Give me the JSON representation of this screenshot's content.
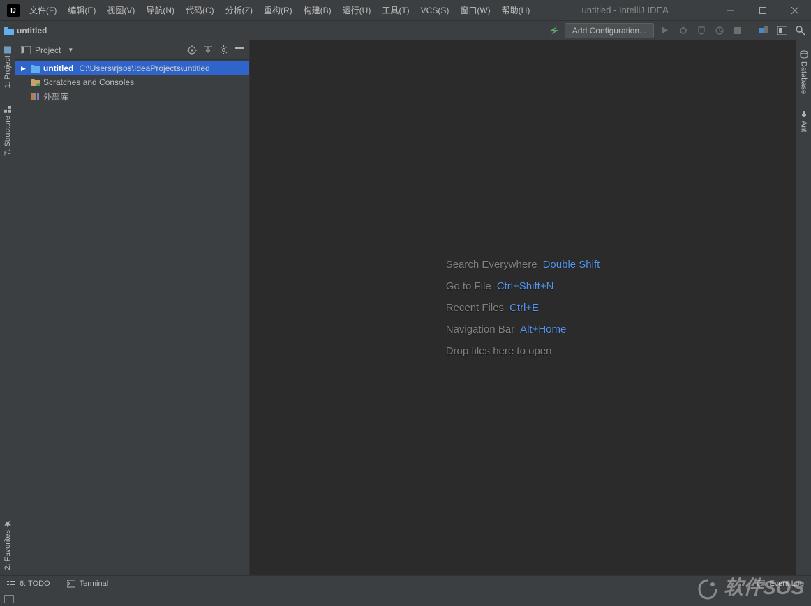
{
  "window": {
    "title": "untitled - IntelliJ IDEA"
  },
  "menu": [
    "文件(F)",
    "编辑(E)",
    "视图(V)",
    "导航(N)",
    "代码(C)",
    "分析(Z)",
    "重构(R)",
    "构建(B)",
    "运行(U)",
    "工具(T)",
    "VCS(S)",
    "窗口(W)",
    "帮助(H)"
  ],
  "breadcrumb": {
    "project": "untitled"
  },
  "toolbar": {
    "config_label": "Add Configuration..."
  },
  "project_panel": {
    "title": "Project",
    "root": {
      "name": "untitled",
      "path": "C:\\Users\\rjsos\\IdeaProjects\\untitled"
    },
    "scratches": "Scratches and Consoles",
    "external": "外部库"
  },
  "left_tabs": {
    "project": "1: Project",
    "structure": "7: Structure",
    "favorites": "2: Favorites"
  },
  "right_tabs": {
    "database": "Database",
    "ant": "Ant"
  },
  "editor_hints": [
    {
      "label": "Search Everywhere",
      "key": "Double Shift"
    },
    {
      "label": "Go to File",
      "key": "Ctrl+Shift+N"
    },
    {
      "label": "Recent Files",
      "key": "Ctrl+E"
    },
    {
      "label": "Navigation Bar",
      "key": "Alt+Home"
    },
    {
      "label": "Drop files here to open",
      "key": ""
    }
  ],
  "bottom": {
    "todo": "6: TODO",
    "terminal": "Terminal",
    "eventlog": "Event Log"
  },
  "watermark": "软件SOS"
}
